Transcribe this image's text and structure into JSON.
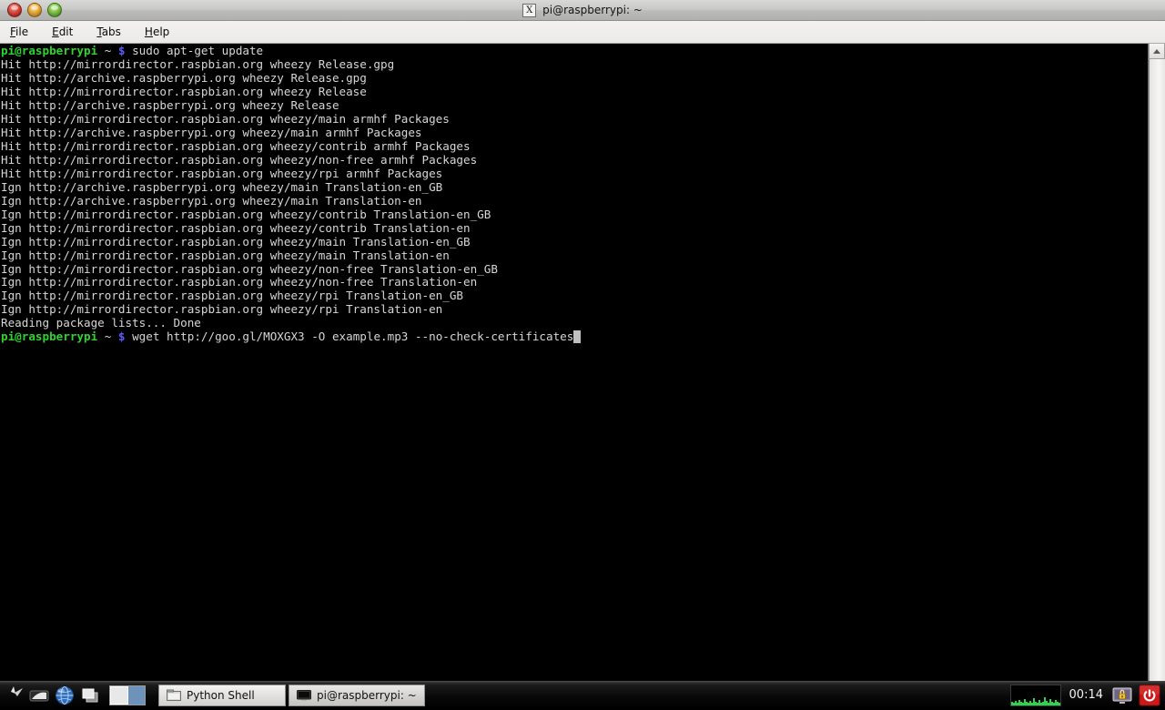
{
  "window": {
    "title": "pi@raspberrypi: ~",
    "title_icon": "x-terminal-icon",
    "buttons": {
      "close": "close-button",
      "minimize": "minimize-button",
      "maximize": "maximize-button"
    }
  },
  "menubar": {
    "items": [
      {
        "label": "File",
        "mnemonic": "F",
        "rest": "ile"
      },
      {
        "label": "Edit",
        "mnemonic": "E",
        "rest": "dit"
      },
      {
        "label": "Tabs",
        "mnemonic": "T",
        "rest": "abs"
      },
      {
        "label": "Help",
        "mnemonic": "H",
        "rest": "elp"
      }
    ]
  },
  "terminal": {
    "prompt": {
      "user_host": "pi@raspberrypi",
      "path": "~",
      "symbol": "$"
    },
    "commands": {
      "first": "sudo apt-get update",
      "current": "wget http://goo.gl/MOXGX3 -O example.mp3 --no-check-certificates"
    },
    "output_lines": [
      "Hit http://mirrordirector.raspbian.org wheezy Release.gpg",
      "Hit http://archive.raspberrypi.org wheezy Release.gpg",
      "Hit http://mirrordirector.raspbian.org wheezy Release",
      "Hit http://archive.raspberrypi.org wheezy Release",
      "Hit http://mirrordirector.raspbian.org wheezy/main armhf Packages",
      "Hit http://archive.raspberrypi.org wheezy/main armhf Packages",
      "Hit http://mirrordirector.raspbian.org wheezy/contrib armhf Packages",
      "Hit http://mirrordirector.raspbian.org wheezy/non-free armhf Packages",
      "Hit http://mirrordirector.raspbian.org wheezy/rpi armhf Packages",
      "Ign http://archive.raspberrypi.org wheezy/main Translation-en_GB",
      "Ign http://archive.raspberrypi.org wheezy/main Translation-en",
      "Ign http://mirrordirector.raspbian.org wheezy/contrib Translation-en_GB",
      "Ign http://mirrordirector.raspbian.org wheezy/contrib Translation-en",
      "Ign http://mirrordirector.raspbian.org wheezy/main Translation-en_GB",
      "Ign http://mirrordirector.raspbian.org wheezy/main Translation-en",
      "Ign http://mirrordirector.raspbian.org wheezy/non-free Translation-en_GB",
      "Ign http://mirrordirector.raspbian.org wheezy/non-free Translation-en",
      "Ign http://mirrordirector.raspbian.org wheezy/rpi Translation-en_GB",
      "Ign http://mirrordirector.raspbian.org wheezy/rpi Translation-en",
      "Reading package lists... Done"
    ],
    "colors": {
      "background": "#000000",
      "foreground": "#d6d6d6",
      "prompt_user": "#2fd42f",
      "prompt_symbol": "#5c5cff",
      "cursor": "#bfbfbf"
    }
  },
  "scrollbar": {
    "up_arrow": "scroll-up-arrow-icon"
  },
  "taskbar": {
    "launchers": [
      {
        "name": "menu-launcher-icon"
      },
      {
        "name": "file-manager-icon"
      },
      {
        "name": "web-browser-icon"
      },
      {
        "name": "window-switcher-icon"
      }
    ],
    "pager": {
      "name": "desktop-pager",
      "desktops": 2,
      "active": 1
    },
    "tasks": [
      {
        "label": "Python Shell",
        "icon": "python-shell-icon",
        "active": false
      },
      {
        "label": "pi@raspberrypi: ~",
        "icon": "terminal-icon",
        "active": true
      }
    ],
    "tray": {
      "cpu_monitor": "cpu-usage-graph",
      "clock": "00:14",
      "lock_icon": "lock-screen-icon",
      "power_icon": "shutdown-icon",
      "power_color": "#cc1a1a"
    }
  }
}
